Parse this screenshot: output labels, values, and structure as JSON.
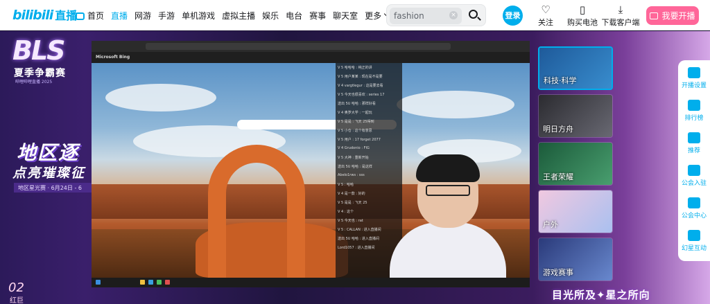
{
  "header": {
    "logo_text": "bilibili",
    "logo_suffix": "直播",
    "nav": [
      {
        "label": "首页",
        "active": false
      },
      {
        "label": "直播",
        "active": true
      },
      {
        "label": "网游",
        "active": false
      },
      {
        "label": "手游",
        "active": false
      },
      {
        "label": "单机游戏",
        "active": false
      },
      {
        "label": "虚拟主播",
        "active": false
      },
      {
        "label": "娱乐",
        "active": false
      },
      {
        "label": "电台",
        "active": false
      },
      {
        "label": "赛事",
        "active": false
      },
      {
        "label": "聊天室",
        "active": false
      },
      {
        "label": "更多",
        "active": false
      }
    ],
    "search": {
      "value": "fashion",
      "clear": "×"
    },
    "login_label": "登录",
    "right": [
      {
        "label": "关注",
        "icon": "heart-icon",
        "glyph": "♡"
      },
      {
        "label": "购买电池",
        "icon": "battery-icon",
        "glyph": "▯"
      },
      {
        "label": "下载客户端",
        "icon": "download-icon",
        "glyph": "⤓"
      }
    ],
    "open_live_label": "我要开播",
    "accent": "#00aeec",
    "pink": "#ff6699"
  },
  "promo": {
    "bls": "BLS",
    "bls_sub": "夏季争霸赛",
    "bls_small": "哔哩哔哩直播 2025",
    "region_title": "地区逐",
    "region_sub": "点亮璀璨征",
    "region_bar": "地区星光赛 · 6月24日 - 6",
    "corner_num": "02",
    "corner_text": "红巨",
    "slogan": "目光所及✦星之所向"
  },
  "video": {
    "browser_title": "Microsoft Bing",
    "chat_lines": [
      "V 5 哈哈哈 : 纯正的讲",
      "V 5 用户某某 : 现在是不是要",
      "V 4 vargtlegur : 这是要去看",
      "V 5 今天也很喜欢 : series 17",
      "送出 5U 哈哈 : 那样好看",
      "V 4 奥罗大学 : 一起玩",
      "V 5 是是 : 飞天  25得到",
      "V 5 小仓 : 这个有意思",
      "V 5 用户 : 17 forget 2077",
      "V 4 Grudonio : FIG",
      "V 5 大神 : 重新开始",
      "送出 5U 哈哈 : 是这样",
      "Abelo1rws : sss",
      "V 5 : 哈哈",
      "V 4 是一款 : 好的",
      "V 5 是是 : 飞天 25",
      "V 4 : 这个",
      "V 5 今天也 : rat",
      "V 5 : CALLAN : 进入直播间",
      "送出 5U 哈哈 : 进入直播间",
      "Lord1057 : 进入直播间"
    ]
  },
  "recommend": [
    {
      "label": "科技·科学",
      "selected": true,
      "color": "#3a8fd0"
    },
    {
      "label": "明日方舟",
      "selected": false,
      "color": "#4a4a52"
    },
    {
      "label": "王者荣耀",
      "selected": false,
      "color": "#2b7a5a"
    },
    {
      "label": "户外",
      "selected": false,
      "color": "#c8a0d8"
    },
    {
      "label": "游戏赛事",
      "selected": false,
      "color": "#3c4a8a"
    }
  ],
  "sidebar": [
    {
      "label": "开播设置",
      "icon": "broadcast-settings-icon"
    },
    {
      "label": "排行榜",
      "icon": "ranking-icon"
    },
    {
      "label": "推荐",
      "icon": "recommend-icon"
    },
    {
      "label": "公会入驻",
      "icon": "guild-join-icon"
    },
    {
      "label": "公会中心",
      "icon": "guild-center-icon"
    },
    {
      "label": "幻星互动",
      "icon": "interaction-icon"
    }
  ]
}
